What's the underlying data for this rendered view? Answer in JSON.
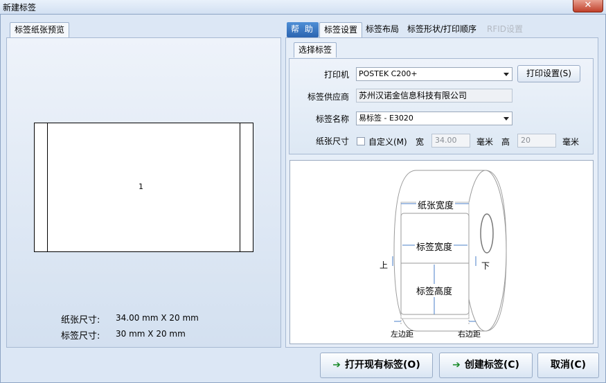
{
  "window": {
    "title": "新建标签",
    "close_glyph": "✕"
  },
  "left": {
    "tab": "标签纸张预览",
    "preview_number": "1",
    "paper_size_label": "纸张尺寸:",
    "paper_size_value": "34.00 mm X 20 mm",
    "label_size_label": "标签尺寸:",
    "label_size_value": "30 mm X 20 mm"
  },
  "tabs": [
    {
      "label": "帮 助"
    },
    {
      "label": "标签设置"
    },
    {
      "label": "标签布局"
    },
    {
      "label": "标签形状/打印顺序"
    },
    {
      "label": "RFID设置"
    }
  ],
  "subtab": "选择标签",
  "form": {
    "printer_label": "打印机",
    "printer_value": "POSTEK C200+",
    "print_settings_button": "打印设置(S)",
    "supplier_label": "标签供应商",
    "supplier_value": "苏州汉诺金信息科技有限公司",
    "name_label": "标签名称",
    "name_value": "易标签 - E3020",
    "size_label": "纸张尺寸",
    "custom_label": "自定义(M)",
    "width_label": "宽",
    "width_value": "34.00",
    "unit1": "毫米",
    "height_label": "高",
    "height_value": "20",
    "unit2": "毫米"
  },
  "diagram": {
    "paper_width": "纸张宽度",
    "label_width": "标签宽度",
    "label_height": "标签高度",
    "top": "上",
    "bottom": "下",
    "left_margin": "左边距",
    "right_margin": "右边距"
  },
  "buttons": {
    "open": "打开现有标签(O)",
    "create": "创建标签(C)",
    "cancel": "取消(C)"
  },
  "colors": {
    "accent": "#2b64b0",
    "arrow": "#1a8a2a",
    "dim_line": "#4a7fc8"
  }
}
